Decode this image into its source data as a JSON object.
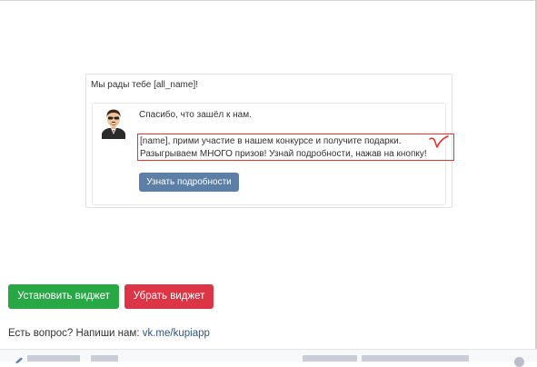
{
  "widget_preview": {
    "greeting": "Мы рады тебе [all_name]!",
    "thanks": "Спасибо, что зашёл к нам.",
    "offer_line1": "[name], прими участие в нашем конкурсе и получите подарки.",
    "offer_line2": "Разыгрываем МНОГО призов! Узнай подробности, нажав на кнопку!",
    "details_button": "Узнать подробности"
  },
  "actions": {
    "install_label": "Установить виджет",
    "remove_label": "Убрать виджет"
  },
  "contact": {
    "prompt": "Есть вопрос? Напиши нам:",
    "link_text": "vk.me/kupiapp"
  },
  "colors": {
    "install": "#28a745",
    "remove": "#dc3545",
    "details_button": "#5b7fa6",
    "highlight": "#e8342f",
    "link": "#2a5885"
  }
}
